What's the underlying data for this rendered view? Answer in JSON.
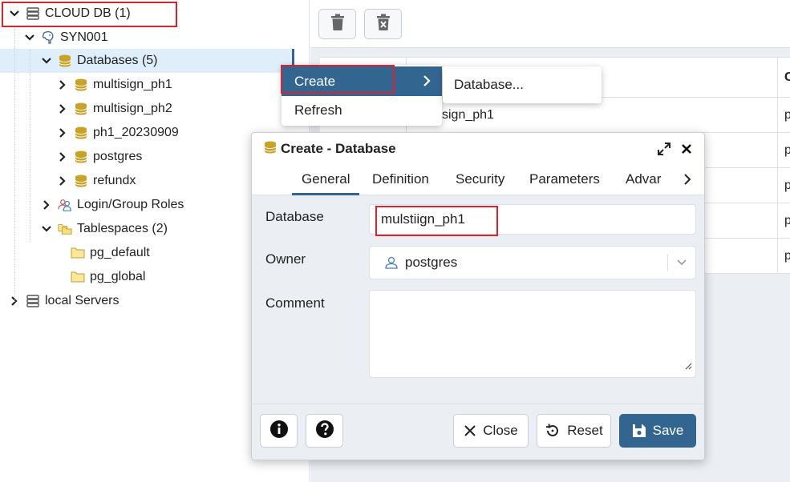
{
  "tree": {
    "items": [
      {
        "label": "CLOUD DB (1)",
        "icon": "server-group-icon",
        "expanded": true
      },
      {
        "label": "SYN001",
        "icon": "postgres-elephant-icon",
        "expanded": true
      },
      {
        "label": "Databases (5)",
        "icon": "databases-icon",
        "expanded": true
      },
      {
        "label": "multisign_ph1",
        "icon": "database-icon",
        "expanded": false
      },
      {
        "label": "multisign_ph2",
        "icon": "database-icon",
        "expanded": false
      },
      {
        "label": "ph1_20230909",
        "icon": "database-icon",
        "expanded": false
      },
      {
        "label": "postgres",
        "icon": "database-icon",
        "expanded": false
      },
      {
        "label": "refundx",
        "icon": "database-icon",
        "expanded": false
      },
      {
        "label": "Login/Group Roles",
        "icon": "roles-icon",
        "expanded": false
      },
      {
        "label": "Tablespaces (2)",
        "icon": "tablespaces-icon",
        "expanded": true
      },
      {
        "label": "pg_default",
        "icon": "folder-icon"
      },
      {
        "label": "pg_global",
        "icon": "folder-icon"
      },
      {
        "label": "local Servers",
        "icon": "server-group-icon",
        "expanded": false
      }
    ]
  },
  "grid": {
    "rows": [
      {
        "name": "",
        "extra": "C"
      },
      {
        "name": "sign_ph1",
        "extra": "p"
      },
      {
        "name": "",
        "extra": "p"
      },
      {
        "name": "",
        "extra": "p"
      },
      {
        "name": "",
        "extra": "p"
      },
      {
        "name": "",
        "extra": "p"
      }
    ]
  },
  "context_menu": {
    "create": "Create",
    "refresh": "Refresh",
    "submenu_database": "Database..."
  },
  "dialog": {
    "title": "Create - Database",
    "tabs": [
      "General",
      "Definition",
      "Security",
      "Parameters",
      "Advar"
    ],
    "active_tab": "General",
    "fields": {
      "database_label": "Database",
      "database_value": "mulstiign_ph1",
      "owner_label": "Owner",
      "owner_value": "postgres",
      "comment_label": "Comment",
      "comment_value": ""
    },
    "buttons": {
      "close": "Close",
      "reset": "Reset",
      "save": "Save"
    }
  },
  "colors": {
    "accent": "#326690",
    "highlight_red": "#d9232e",
    "db_gold": "#c9a227",
    "selection_bg": "#dfeefb"
  }
}
